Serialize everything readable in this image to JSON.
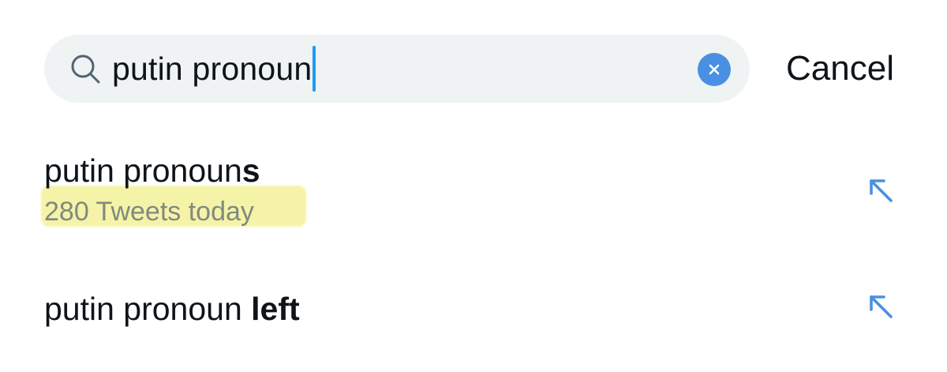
{
  "search": {
    "query": "putin pronoun",
    "icon": "search-icon",
    "clear_icon": "close-icon",
    "clear_color": "#4a90e2",
    "caret_color": "#1d9bf0"
  },
  "cancel_label": "Cancel",
  "suggestions": [
    {
      "prefix": "putin pronoun",
      "completion": "s",
      "meta": "280 Tweets today",
      "meta_highlighted": true,
      "icon": "arrow-up-left-icon"
    },
    {
      "prefix": "putin pronoun ",
      "completion": "left",
      "icon": "arrow-up-left-icon"
    }
  ],
  "colors": {
    "search_background": "#eff3f4",
    "text": "#0f1419",
    "arrow": "#4a90e2",
    "highlight": "#f5f3a4",
    "meta_text": "#808a7e"
  }
}
